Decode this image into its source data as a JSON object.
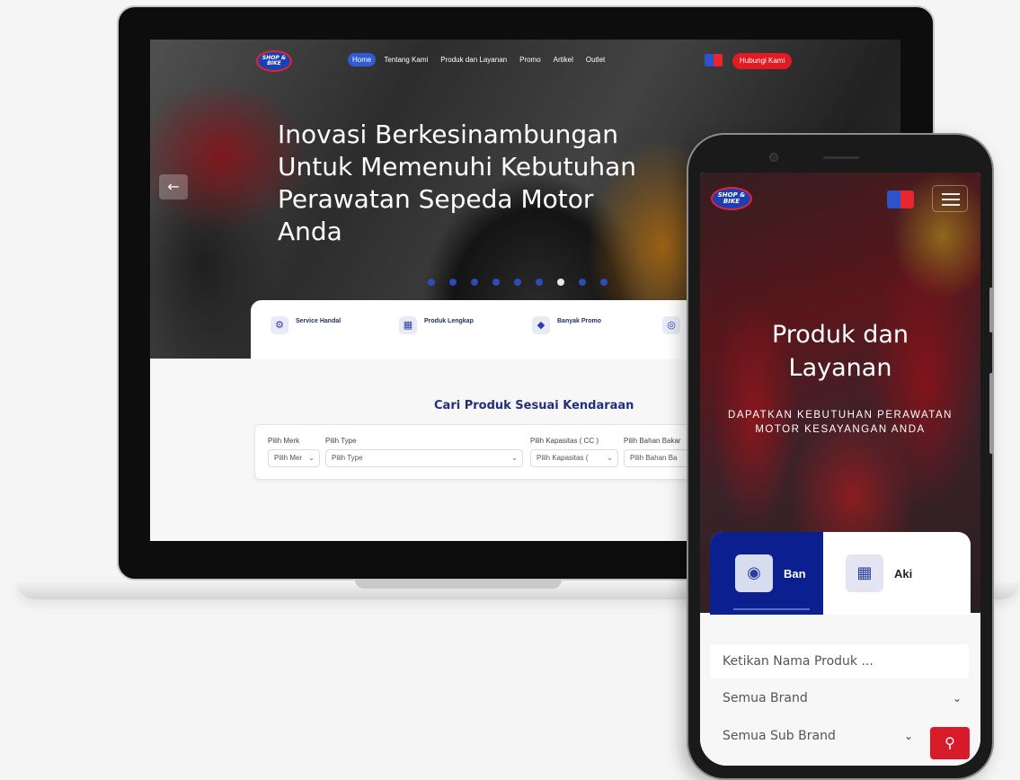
{
  "desktop": {
    "logo_text": "SHOP & BIKE",
    "nav": {
      "items": [
        "Home",
        "Tentang Kami",
        "Produk dan Layanan",
        "Promo",
        "Artikel",
        "Outlet"
      ],
      "active_index": 0,
      "contact_label": "Hubungi Kami"
    },
    "hero": {
      "title_lines": [
        "Inovasi Berkesinambungan",
        "Untuk Memenuhi Kebutuhan",
        "Perawatan Sepeda Motor",
        "Anda"
      ],
      "slide_count": 9,
      "active_slide": 6,
      "prev_icon": "arrow-left-icon"
    },
    "features": [
      {
        "label": "Service Handal",
        "icon": "wrench-icon"
      },
      {
        "label": "Produk Lengkap",
        "icon": "boxes-icon"
      },
      {
        "label": "Banyak Promo",
        "icon": "tag-icon"
      }
    ],
    "search": {
      "title": "Cari Produk Sesuai Kendaraan",
      "fields": [
        {
          "label": "Pilih Merk",
          "value": "Pilih Mer"
        },
        {
          "label": "Pilih Type",
          "value": "Pilih Type"
        },
        {
          "label": "Pilih Kapasitas ( CC )",
          "value": "Pilih Kapasitas ("
        },
        {
          "label": "Pilih Bahan Bakar",
          "value": "Pilih Bahan Ba"
        }
      ]
    }
  },
  "mobile": {
    "logo_text": "SHOP & BIKE",
    "hero": {
      "title_line1": "Produk dan",
      "title_line2": "Layanan",
      "subtitle": "DAPATKAN KEBUTUHAN PERAWATAN MOTOR KESAYANGAN ANDA"
    },
    "tabs": [
      {
        "label": "Ban",
        "icon": "tire-icon",
        "active": true
      },
      {
        "label": "Aki",
        "icon": "battery-icon",
        "active": false
      }
    ],
    "form": {
      "search_placeholder": "Ketikan Nama Produk ...",
      "brand_select": "Semua Brand",
      "sub_brand_select": "Semua Sub Brand",
      "search_icon": "search-icon"
    }
  },
  "colors": {
    "brand_blue": "#0b1f8f",
    "nav_active": "#2f5bd6",
    "accent_red": "#e21b23",
    "heading_navy": "#22307a"
  }
}
